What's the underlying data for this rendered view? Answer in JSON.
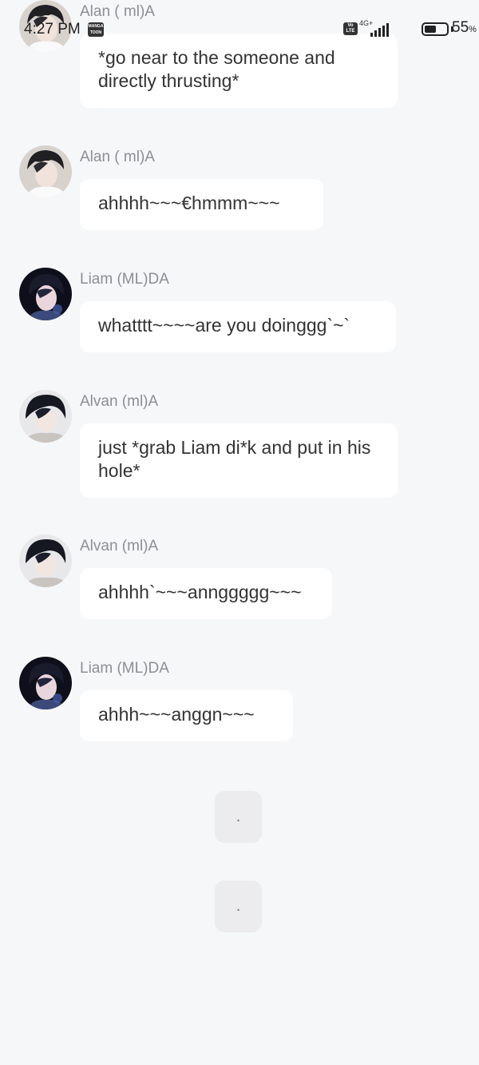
{
  "status_bar": {
    "time": "4:27 PM",
    "app_icon_text": "MANGA TOON",
    "volte": "Vo LTE",
    "network": "4G+",
    "battery_percent": "55",
    "battery_unit": "%",
    "battery_level": 0.55
  },
  "messages": [
    {
      "sender": "Alan ( ml)A",
      "text": "*go near to the someone and directly thrusting*",
      "avatar": "alan-avatar"
    },
    {
      "sender": "Alan ( ml)A",
      "text": "ahhhh~~~€hmmm~~~",
      "avatar": "alan-avatar"
    },
    {
      "sender": "Liam (ML)DA",
      "text": "whatttt~~~~are you doinggg`~`",
      "avatar": "liam-avatar"
    },
    {
      "sender": "Alvan (ml)A",
      "text": "just *grab Liam di*k and put in his hole*",
      "avatar": "alvan-avatar"
    },
    {
      "sender": "Alvan (ml)A",
      "text": "ahhhh`~~~annggggg~~~",
      "avatar": "alvan-avatar"
    },
    {
      "sender": "Liam (ML)DA",
      "text": "ahhh~~~anggn~~~",
      "avatar": "liam-avatar"
    }
  ],
  "typing_bubbles": [
    ".",
    "."
  ],
  "colors": {
    "background": "#f6f7f9",
    "bubble": "#ffffff",
    "sender_name": "#8e8e93",
    "text": "#333333"
  }
}
